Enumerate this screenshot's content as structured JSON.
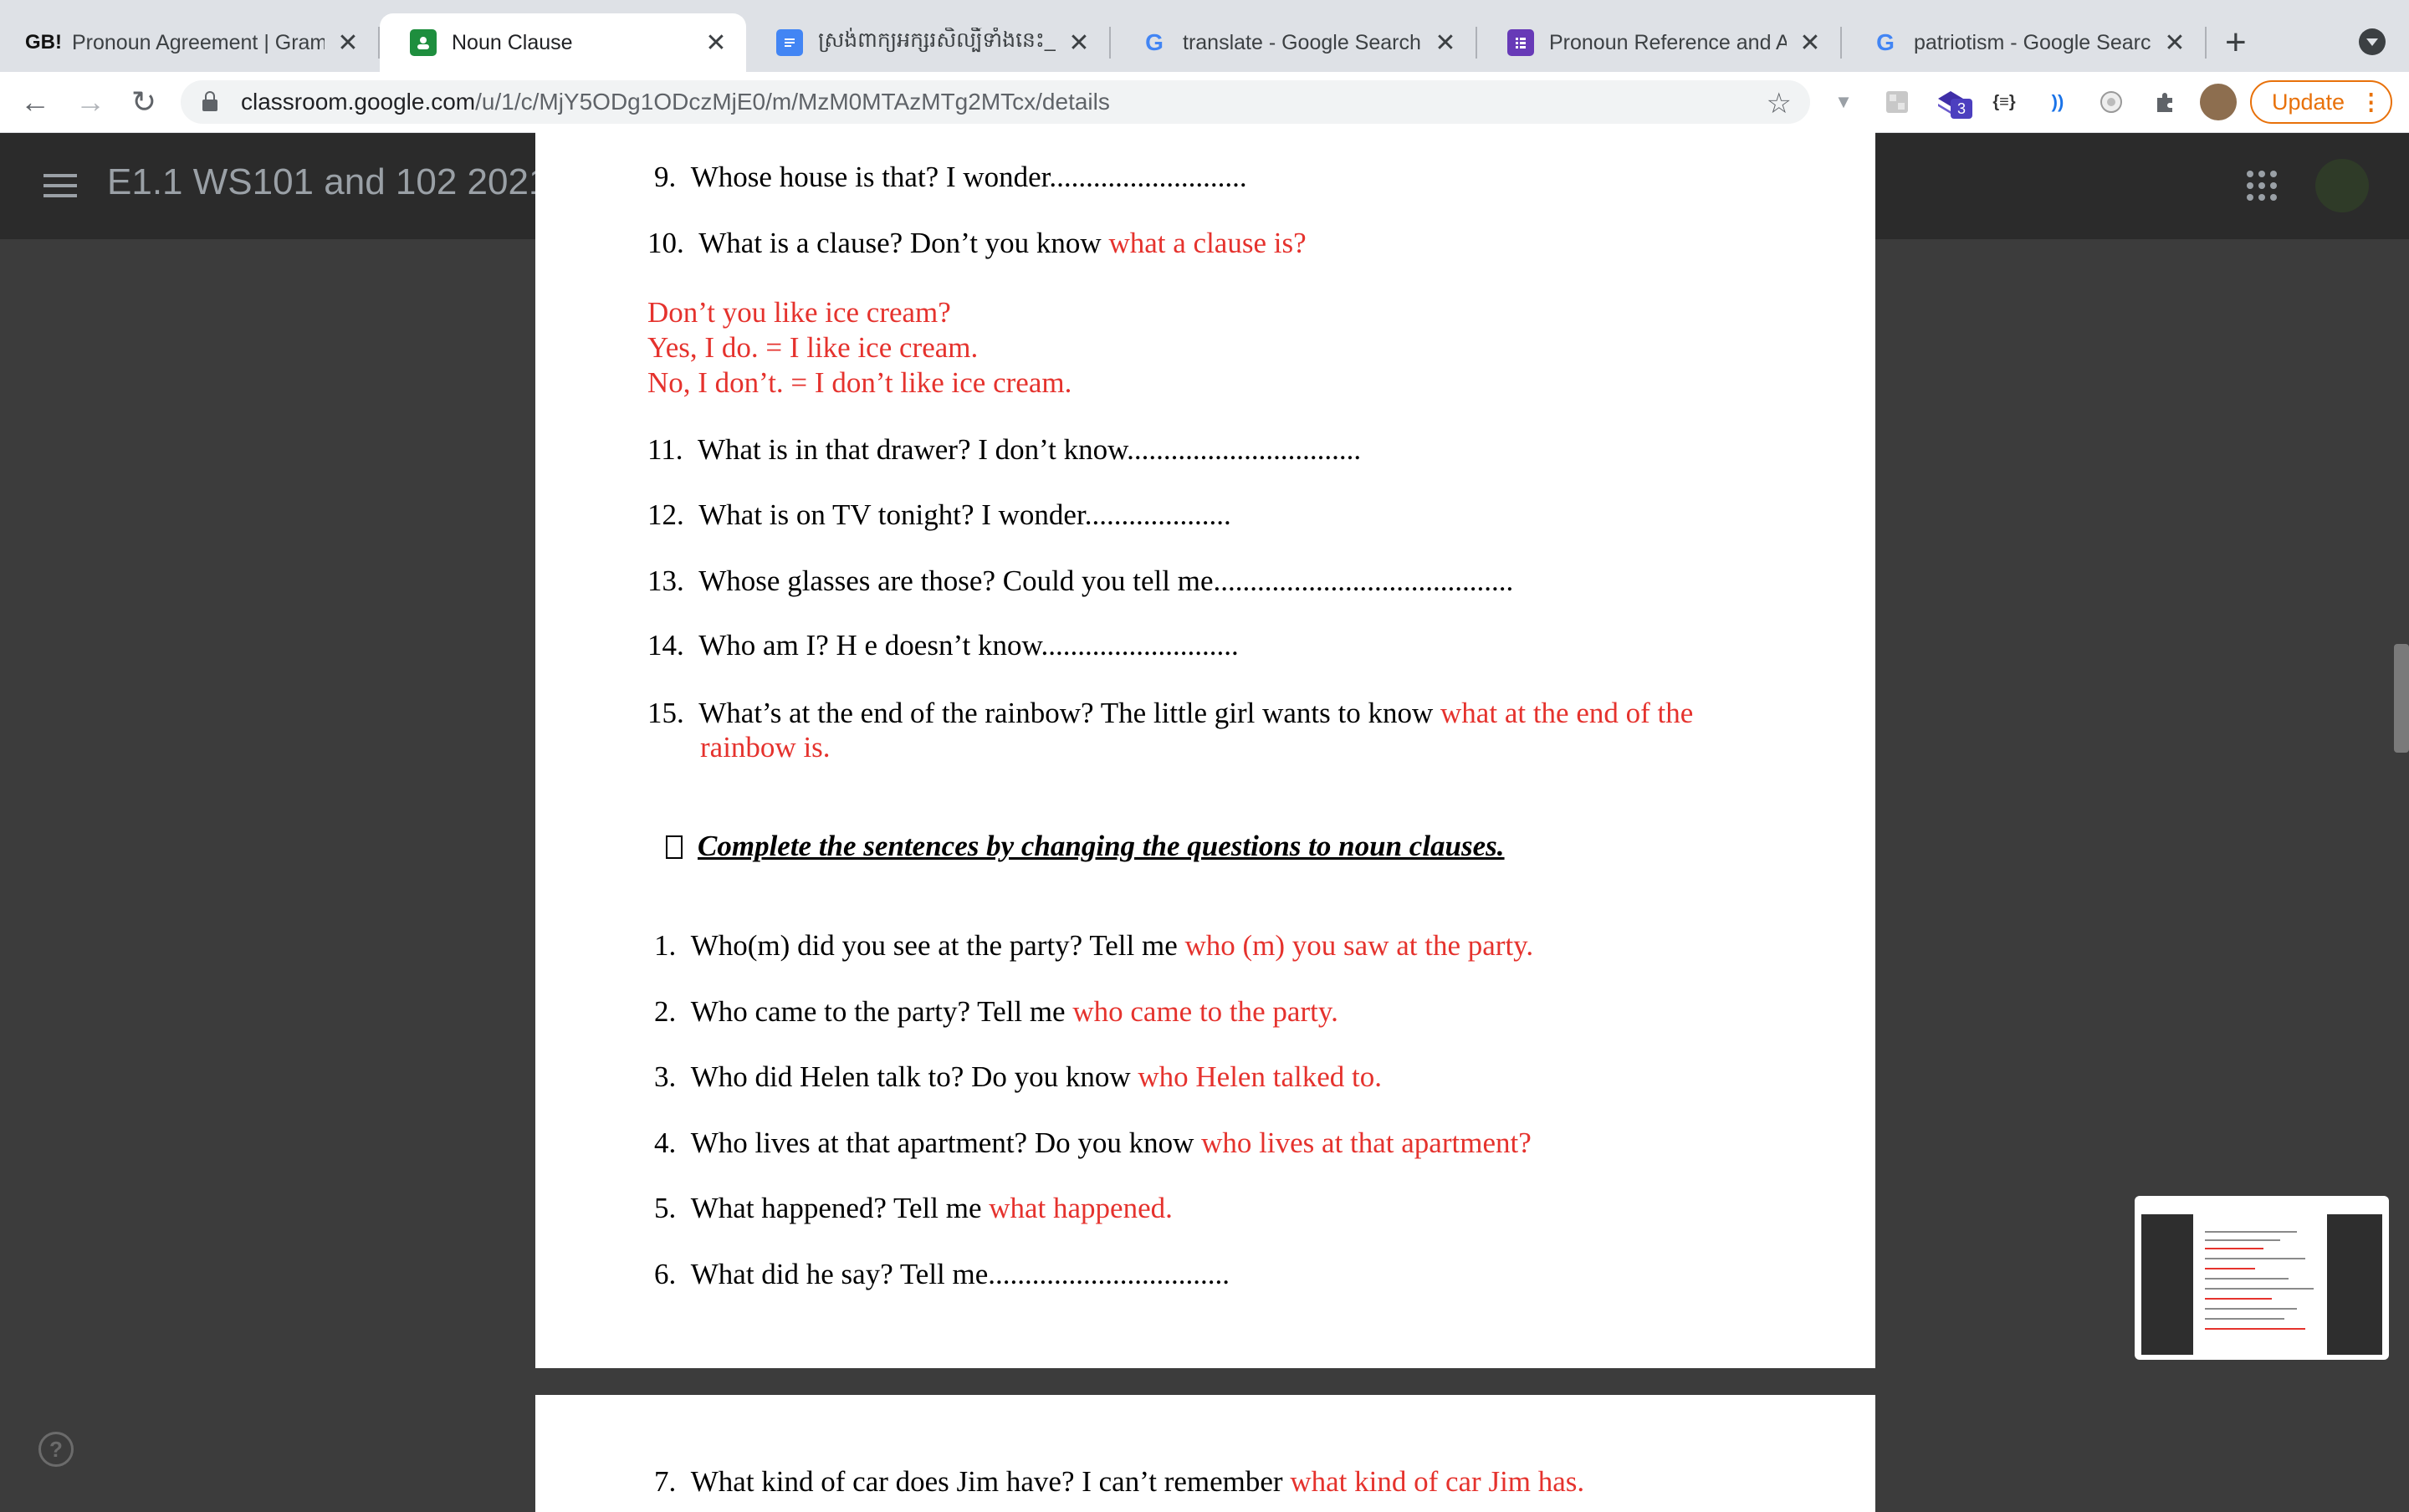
{
  "browser": {
    "tabs": [
      {
        "favicon": "GB!",
        "title": "Pronoun Agreement | Gramm",
        "active": false
      },
      {
        "favicon": "classroom",
        "title": "Noun Clause",
        "active": true
      },
      {
        "favicon": "docs",
        "title": "ស្រង់ពាក្យអក្សរសិល្បិ៍ទាំងនេះ_ដែលក្លែ",
        "active": false
      },
      {
        "favicon": "G",
        "title": "translate - Google Search",
        "active": false
      },
      {
        "favicon": "forms",
        "title": "Pronoun Reference and Agr",
        "active": false
      },
      {
        "favicon": "G",
        "title": "patriotism - Google Search",
        "active": false
      }
    ],
    "url_domain": "classroom.google.com",
    "url_path": "/u/1/c/MjY5ODg1ODczMjE0/m/MzM0MTAzMTg2MTcx/details",
    "extension_badge": "3",
    "extension_label": "{≡}",
    "update_label": "Update"
  },
  "classroom": {
    "class_title": "E1.1 WS101 and 102 2021",
    "help_label": "?"
  },
  "document": {
    "part_a": [
      {
        "num": "9.",
        "question": "Whose house is that?  I wonder",
        "answer": "",
        "dots": "..........................."
      },
      {
        "num": "10.",
        "question": "What is a clause?  Don’t you know ",
        "answer": "what a clause is?",
        "dots": ""
      }
    ],
    "note": [
      "Don’t you like ice cream?",
      "Yes, I do. = I like ice cream.",
      "No, I don’t. = I don’t like ice cream."
    ],
    "part_b": [
      {
        "num": "11.",
        "question": "What is in that drawer?  I don’t know",
        "answer": "",
        "dots": "................................"
      },
      {
        "num": "12.",
        "question": "What is on TV tonight?  I wonder",
        "answer": "",
        "dots": "...................."
      },
      {
        "num": "13.",
        "question": "Whose glasses are those?  Could you tell me",
        "answer": "",
        "dots": "........................................."
      },
      {
        "num": "14.",
        "question": "Who am I?   H e doesn’t know",
        "answer": "",
        "dots": "..........................."
      }
    ],
    "item15": {
      "num": "15.",
      "question": "What’s at the end of the rainbow?  The little girl wants to know ",
      "answer_line1": "what at the end of the",
      "answer_line2": "rainbow is."
    },
    "instruction": "Complete the sentences by changing the questions to noun clauses.",
    "exercise": [
      {
        "num": "1.",
        "question": "Who(m) did you see at the party?  Tell me ",
        "answer": "who (m) you saw at the party.",
        "dots": ""
      },
      {
        "num": "2.",
        "question": "Who came to the party?  Tell me ",
        "answer": "who came to the party.",
        "dots": ""
      },
      {
        "num": "3.",
        "question": "Who did Helen talk to?  Do you know ",
        "answer": "who Helen talked to.",
        "dots": ""
      },
      {
        "num": "4.",
        "question": "Who lives at that apartment?  Do you know ",
        "answer": "who lives at that apartment?",
        "dots": ""
      },
      {
        "num": "5.",
        "question": "What happened?  Tell me ",
        "answer": "what happened.",
        "dots": ""
      },
      {
        "num": "6.",
        "question": "What did he say?  Tell me",
        "answer": "",
        "dots": "................................."
      }
    ],
    "page2": [
      {
        "num": "7.",
        "question": "What kind of car does Jim have?  I can’t remember ",
        "answer": "what kind of car Jim has.",
        "dots": ""
      }
    ]
  },
  "colors": {
    "answer_red": "#e5322d",
    "update_orange": "#e8710a",
    "dark_bg": "#3c3c3c"
  }
}
